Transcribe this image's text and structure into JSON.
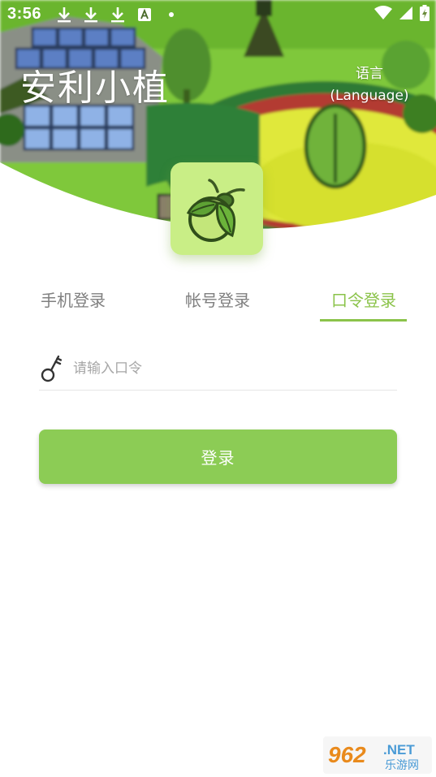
{
  "status_bar": {
    "time": "3:56",
    "left_icons": [
      "download-icon",
      "download-icon",
      "download-icon",
      "font-icon",
      "dot-icon"
    ],
    "right_icons": [
      "wifi-icon",
      "signal-icon",
      "battery-charging-icon"
    ]
  },
  "header": {
    "app_title": "安利小植",
    "language_line1": "语言",
    "language_line2": "(Language)"
  },
  "tabs": [
    {
      "label": "手机登录",
      "active": false
    },
    {
      "label": "帐号登录",
      "active": false
    },
    {
      "label": "口令登录",
      "active": true
    }
  ],
  "code_field": {
    "icon": "key-icon",
    "placeholder": "请输入口令",
    "value": ""
  },
  "login_button": {
    "label": "登录"
  },
  "watermark": {
    "brand": "962",
    "suffix": ".NET",
    "sub": "乐游网"
  },
  "colors": {
    "accent": "#8bc34a",
    "button": "#8ccc55",
    "tab_inactive": "#808080",
    "logo_bg": "#c9ee86"
  }
}
